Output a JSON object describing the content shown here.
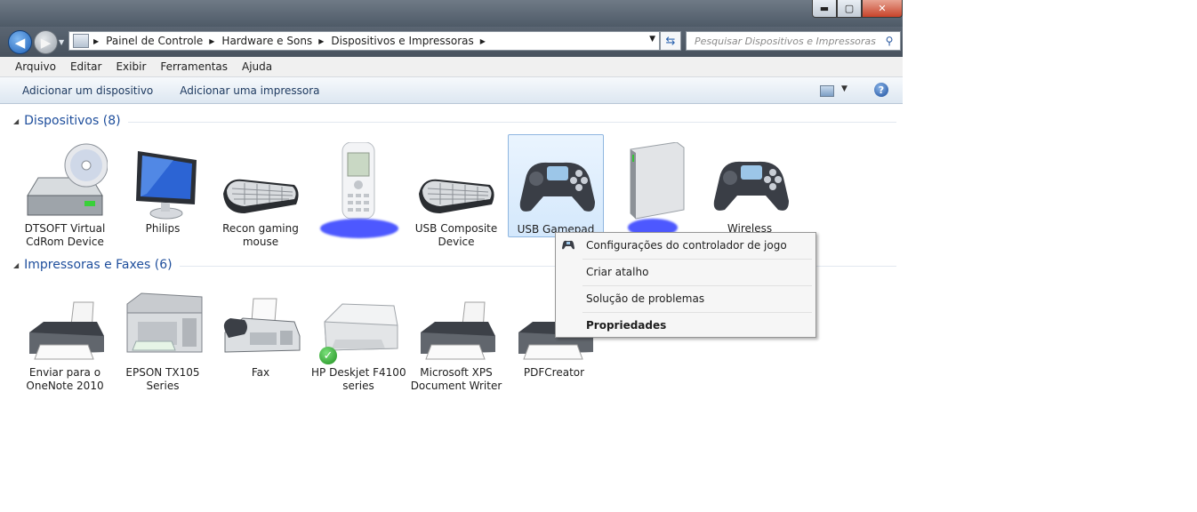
{
  "window": {
    "controls": {
      "min": "▬",
      "max": "▢",
      "close": "✕"
    }
  },
  "address": {
    "crumbs": [
      "Painel de Controle",
      "Hardware e Sons",
      "Dispositivos e Impressoras"
    ],
    "search_placeholder": "Pesquisar Dispositivos e Impressoras"
  },
  "menu": [
    "Arquivo",
    "Editar",
    "Exibir",
    "Ferramentas",
    "Ajuda"
  ],
  "commands": {
    "add_device": "Adicionar um dispositivo",
    "add_printer": "Adicionar uma impressora"
  },
  "groups": {
    "devices": {
      "title": "Dispositivos (8)"
    },
    "printers": {
      "title": "Impressoras e Faxes (6)"
    }
  },
  "devices": [
    {
      "line1": "DTSOFT Virtual",
      "line2": "CdRom Device",
      "icon": "cdrom-drive-icon"
    },
    {
      "line1": "Philips",
      "line2": "",
      "icon": "monitor-icon"
    },
    {
      "line1": "Recon gaming",
      "line2": "mouse",
      "icon": "keyboard-icon"
    },
    {
      "line1": "",
      "line2": "",
      "icon": "mobile-phone-icon"
    },
    {
      "line1": "USB Composite",
      "line2": "Device",
      "icon": "keyboard-icon"
    },
    {
      "line1": "USB Gamepad",
      "line2": "",
      "icon": "gamepad-icon"
    },
    {
      "line1": "",
      "line2": "",
      "icon": "external-drive-icon"
    },
    {
      "line1": "Wireless",
      "line2": "",
      "icon": "gamepad-icon"
    }
  ],
  "printers": [
    {
      "line1": "Enviar para o",
      "line2": "OneNote 2010",
      "icon": "printer-icon"
    },
    {
      "line1": "EPSON TX105",
      "line2": "Series",
      "icon": "multifunction-printer-icon"
    },
    {
      "line1": "Fax",
      "line2": "",
      "icon": "fax-icon"
    },
    {
      "line1": "HP Deskjet F4100",
      "line2": "series",
      "icon": "inkjet-printer-icon"
    },
    {
      "line1": "Microsoft XPS",
      "line2": "Document Writer",
      "icon": "printer-icon"
    },
    {
      "line1": "PDFCreator",
      "line2": "",
      "icon": "printer-icon"
    }
  ],
  "context_menu": [
    "Configurações do controlador de jogo",
    "Criar atalho",
    "Solução de problemas",
    "Propriedades"
  ],
  "colors": {
    "accent": "#1e4e9c",
    "selection": "#d4e8fc",
    "default_check": "#2fa12f"
  }
}
